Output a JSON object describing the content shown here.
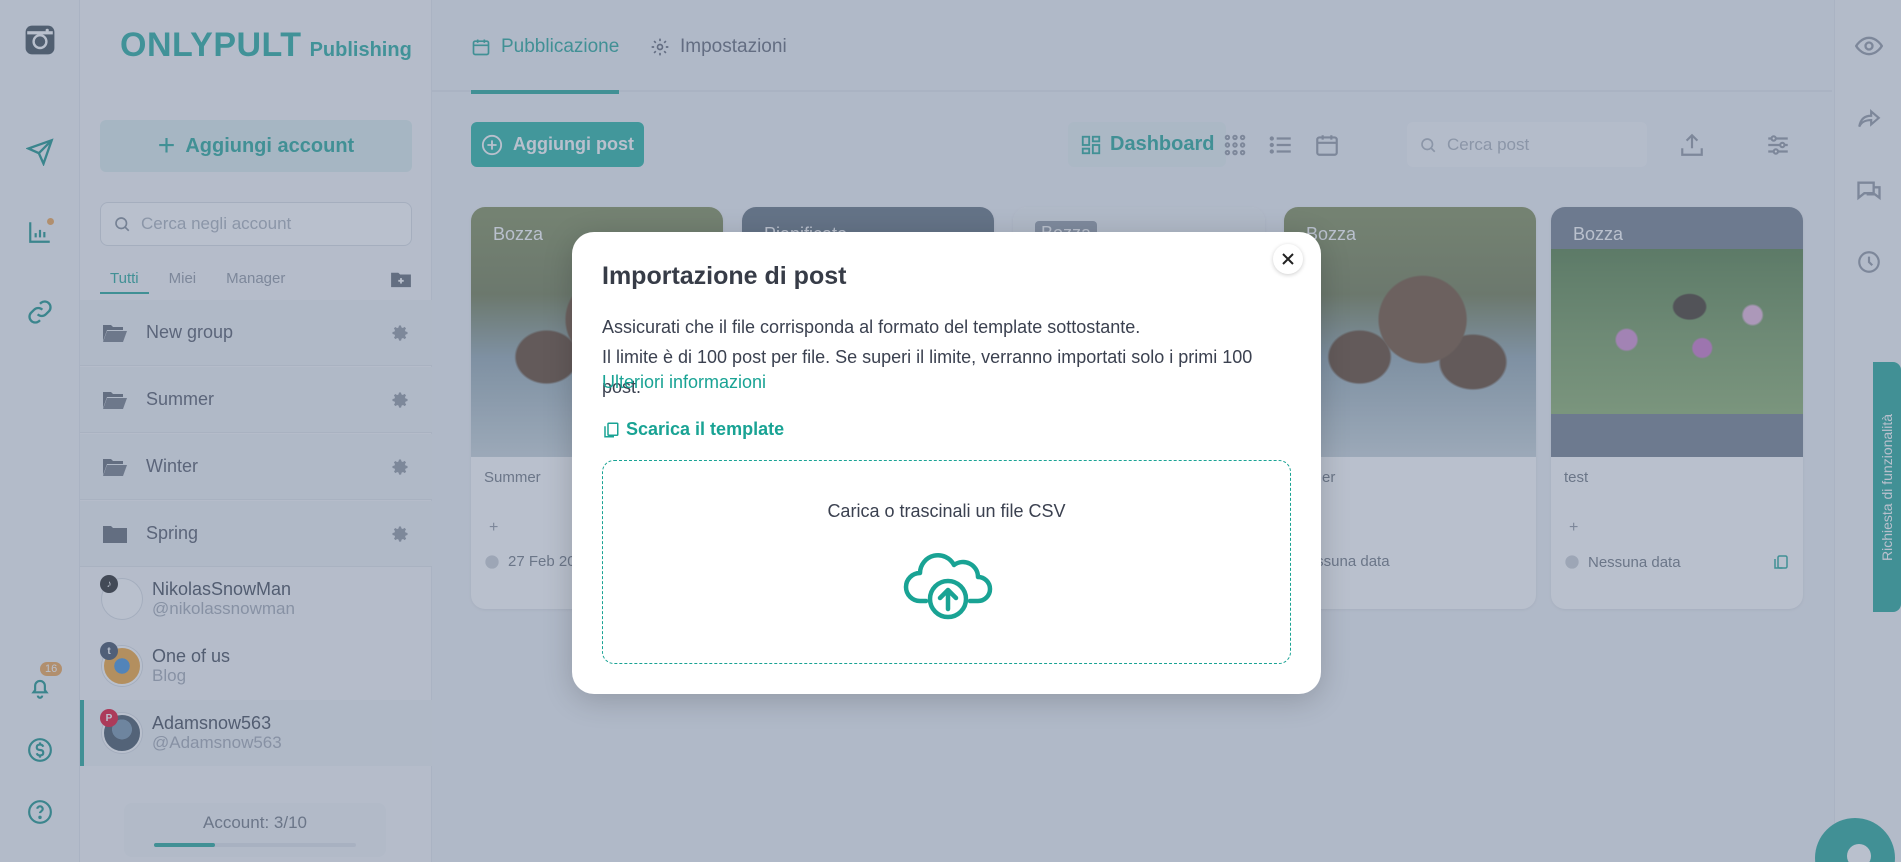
{
  "app": {
    "brand": "ONLYPULT",
    "brand_sub": "Publishing"
  },
  "rail": {
    "notifications_count": "16"
  },
  "sidebar": {
    "add_account_label": "Aggiungi account",
    "search_placeholder": "Cerca negli account",
    "filters": [
      "Tutti",
      "Miei",
      "Manager"
    ],
    "groups": [
      "New group",
      "Summer",
      "Winter",
      "Spring"
    ],
    "accounts": [
      {
        "name": "NikolasSnowMan",
        "handle": "@nikolassnowman",
        "network": "tiktok-icon"
      },
      {
        "name": "One of us",
        "handle": "Blog",
        "network": "tumblr-icon"
      },
      {
        "name": "Adamsnow563",
        "handle": "@Adamsnow563",
        "network": "pinterest-icon"
      }
    ],
    "account_counter": "Account: 3/10",
    "account_fill": 0.3
  },
  "main": {
    "tabs": [
      "Pubblicazione",
      "Impostazioni"
    ],
    "add_post_label": "Aggiungi post",
    "view_dashboard_label": "Dashboard",
    "search_placeholder": "Cerca post",
    "cards": [
      {
        "status": "Bozza",
        "caption": "Summer",
        "date": "27 Feb 20"
      },
      {
        "status": "Pianificato",
        "caption": "",
        "date": ""
      },
      {
        "status": "Bozza",
        "caption": "",
        "date": ""
      },
      {
        "status": "Bozza",
        "caption": "mmer",
        "date": "Nessuna data"
      },
      {
        "status": "Bozza",
        "caption": "test",
        "date": "Nessuna data"
      }
    ]
  },
  "feature_tab": "Richiesta di funzionalità",
  "modal": {
    "title": "Importazione di post",
    "line1": "Assicurati che il file corrisponda al formato del template sottostante.",
    "line2": "Il limite è di 100 post per file. Se superi il limite, verranno importati solo i primi 100 post.",
    "more_link": "Ulteriori informazioni",
    "template_link": "Scarica il template",
    "drop_hint": "Carica o trascinali un file CSV"
  },
  "colors": {
    "accent": "#19a394",
    "overlay": "#6c7c96"
  }
}
